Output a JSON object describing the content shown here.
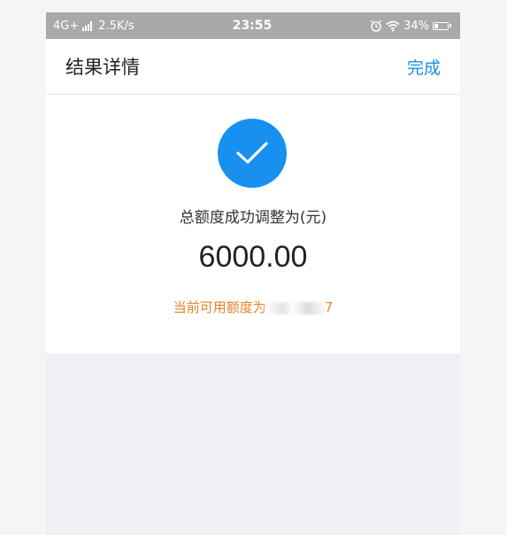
{
  "status_bar": {
    "network": "4G+",
    "speed": "2.5K/s",
    "time": "23:55",
    "battery_percent_text": "34%",
    "battery_level": 0.34
  },
  "nav": {
    "title": "结果详情",
    "done_label": "完成"
  },
  "result": {
    "label": "总额度成功调整为(元)",
    "amount": "6000.00",
    "available_prefix": "当前可用额度为",
    "available_suffix": "7"
  },
  "colors": {
    "accent": "#1890f0",
    "link": "#1a8fe3",
    "warning": "#e8822a"
  },
  "icons": {
    "status": [
      "signal-icon",
      "alarm-icon",
      "wifi-icon",
      "battery-icon"
    ],
    "result": "check-icon"
  }
}
